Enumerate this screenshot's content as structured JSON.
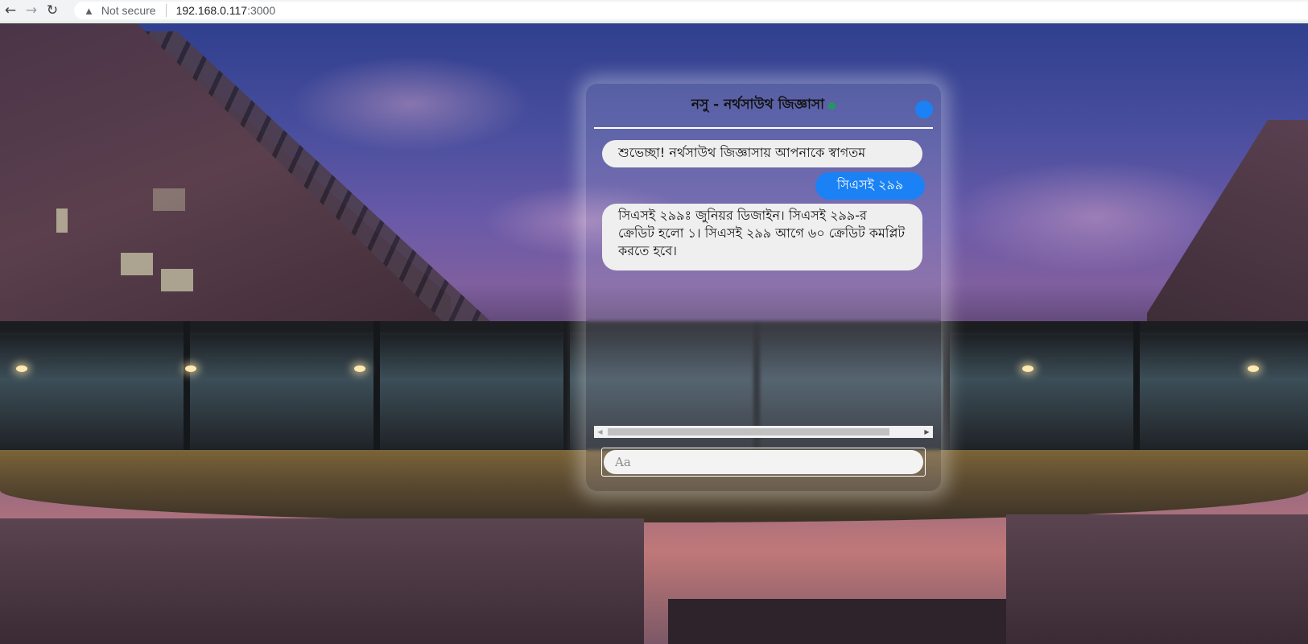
{
  "browser": {
    "security_label": "Not secure",
    "url_host": "192.168.0.117",
    "url_port": ":3000"
  },
  "chat": {
    "title": "নসু - নর্থসাউথ জিজ্ঞাসা",
    "online_color": "#1f9a5e",
    "accent_color": "#1a82f5",
    "messages": [
      {
        "from": "bot",
        "text": "শুভেচ্ছা! নর্থসাউথ জিজ্ঞাসায় আপনাকে স্বাগতম"
      },
      {
        "from": "user",
        "text": "সিএসই ২৯৯"
      },
      {
        "from": "bot",
        "text": "সিএসই ২৯৯ঃ জুনিয়র ডিজাইন। সিএসই ২৯৯-র ক্রেডিট হলো ১। সিএসই ২৯৯ আগে ৬০ ক্রেডিট কমপ্লিট করতে হবে।"
      }
    ],
    "input": {
      "placeholder": "Aa",
      "value": ""
    }
  }
}
